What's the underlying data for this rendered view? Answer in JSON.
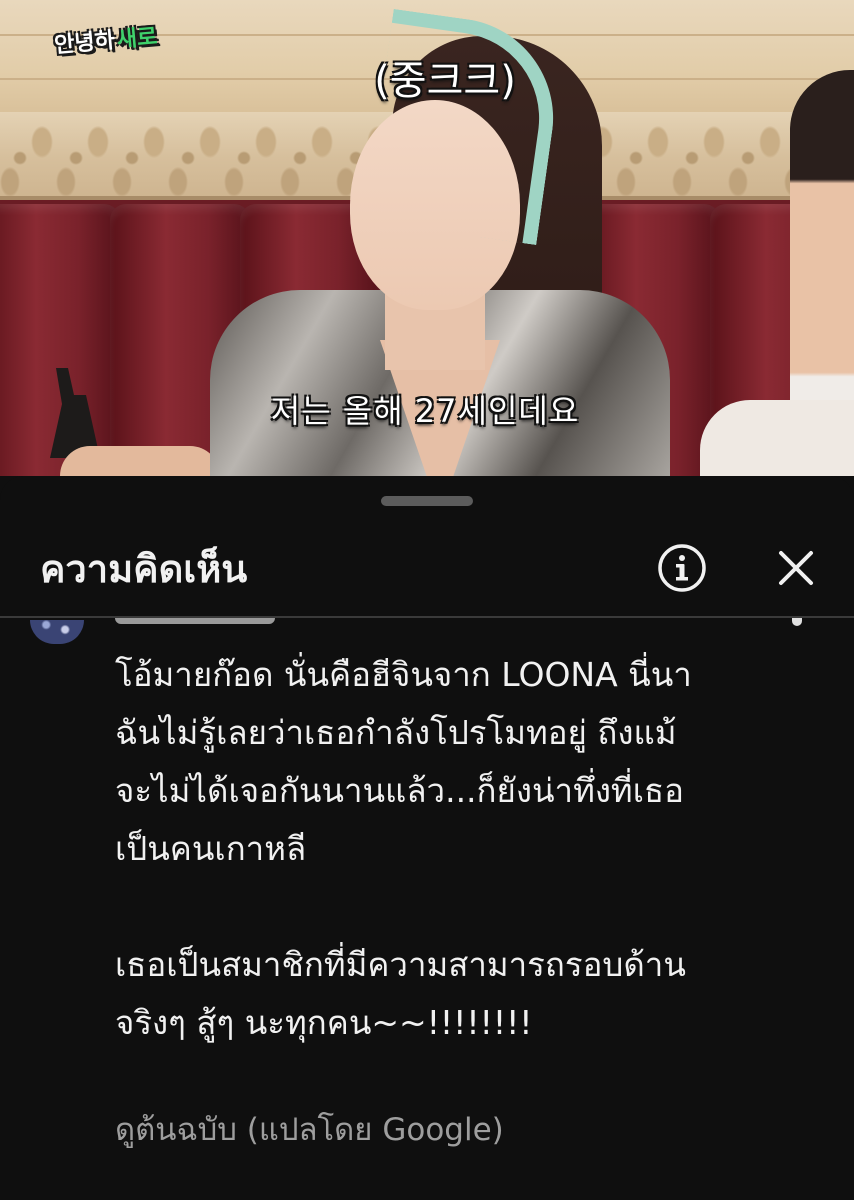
{
  "video": {
    "channel_logo": {
      "part1": "안녕하",
      "part2": "새로"
    },
    "caption_top": "(중크크)",
    "caption_bottom": "저는 올해 27세인데요"
  },
  "comments_panel": {
    "title": "ความคิดเห็น",
    "info_icon": "info-circle-icon",
    "close_icon": "close-x-icon",
    "comment": {
      "lines": [
        "โอ้มายก๊อด นั่นคือฮีจินจาก LOONA นี่นา",
        "ฉันไม่รู้เลยว่าเธอกำลังโปรโมทอยู่ ถึงแม้",
        "จะไม่ได้เจอกันนานแล้ว...ก็ยังน่าทึ่งที่เธอ",
        "เป็นคนเกาหลี",
        "",
        "เธอเป็นสมาชิกที่มีความสามารถรอบด้าน",
        "จริงๆ สู้ๆ นะทุกคน~~!!!!!!!!"
      ],
      "translate_link": "ดูต้นฉบับ (แปลโดย Google)"
    }
  },
  "colors": {
    "panel_bg": "#0f0f0f",
    "text_primary": "#f1f1f1",
    "text_secondary": "#9e9e9e",
    "logo_accent": "#3fd16b"
  }
}
